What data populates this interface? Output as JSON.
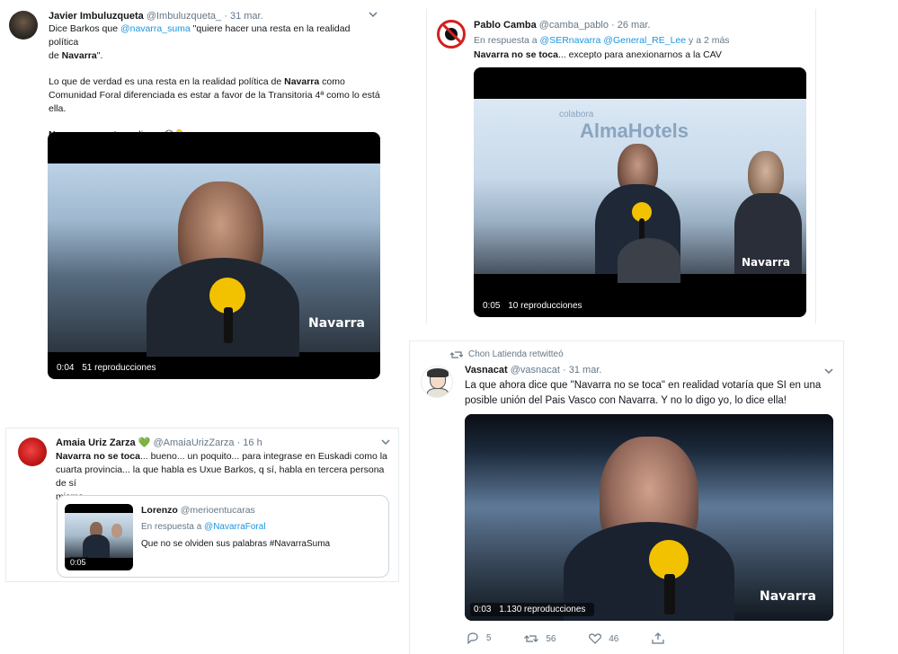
{
  "tweets": {
    "javier": {
      "name": "Javier Imbuluzqueta",
      "handle": "@Imbuluzqueta_",
      "time": "31 mar.",
      "text_1a": "Dice Barkos que ",
      "text_1_link": "@navarra_suma",
      "text_1b": " \"quiere hacer una resta en la realidad política",
      "text_2a": "de ",
      "text_2_bold": "Navarra",
      "text_2b": "\".",
      "text_3a": "Lo que de verdad es una resta en la realidad política de ",
      "text_3_bold": "Navarra",
      "text_3b": " como",
      "text_4": "Comunidad Foral diferenciada es estar a favor de la Transitoria 4ª como lo está",
      "text_5": "ella.",
      "text_6_bold": "Navarra no se toca",
      "text_6b": " dice... 😂👇",
      "video_time": "0:04",
      "video_views": "51 reproducciones",
      "video_logo": "Navarra"
    },
    "pablo": {
      "name": "Pablo Camba",
      "handle": "@camba_pablo",
      "time": "26 mar.",
      "reply_prefix": "En respuesta a ",
      "reply_users": "@SERnavarra @General_RE_Lee",
      "reply_suffix": " y a 2 más",
      "text_bold": "Navarra no se toca",
      "text_rest": "... excepto para anexionarnos a la CAV",
      "video_time": "0:05",
      "video_views": "10 reproducciones",
      "video_brand_small": "colabora",
      "video_brand": "AlmaHotels",
      "video_logo": "Navarra"
    },
    "amaia": {
      "name": "Amaia Uriz Zarza",
      "heart": "💚",
      "handle": "@AmaiaUrizZarza",
      "time": "16 h",
      "text_1_bold": "Navarra no se toca",
      "text_1b": "... bueno... un poquito... para integrase en Euskadi como la",
      "text_2": "cuarta provincia... la que habla es Uxue Barkos, q sí, habla en tercera persona de sí",
      "text_3": "misma.",
      "quote": {
        "name": "Lorenzo",
        "handle": "@merioentucaras",
        "reply_prefix": "En respuesta a ",
        "reply_user": "@NavarraForal",
        "text": "Que no se olviden sus palabras #NavarraSuma",
        "video_time": "0:05"
      }
    },
    "vasnacat": {
      "retweet_label": "Chon Latienda retwitteó",
      "name": "Vasnacat",
      "handle": "@vasnacat",
      "time": "31 mar.",
      "text_1": "La que ahora dice que \"Navarra no se toca\" en realidad votaría que SI en una",
      "text_2": "posible unión del Pais Vasco con Navarra. Y no lo digo yo, lo dice ella!",
      "video_time": "0:03",
      "video_views": "1.130 reproducciones",
      "video_logo": "Navarra",
      "replies": "5",
      "retweets": "56",
      "likes": "46"
    }
  },
  "colors": {
    "link": "#1b95e0",
    "muted": "#657786",
    "text": "#14171a",
    "border": "#e6ecf0"
  },
  "icons": [
    "chevron-down-icon",
    "retweet-icon",
    "reply-icon",
    "like-icon",
    "share-icon",
    "play-bar"
  ]
}
